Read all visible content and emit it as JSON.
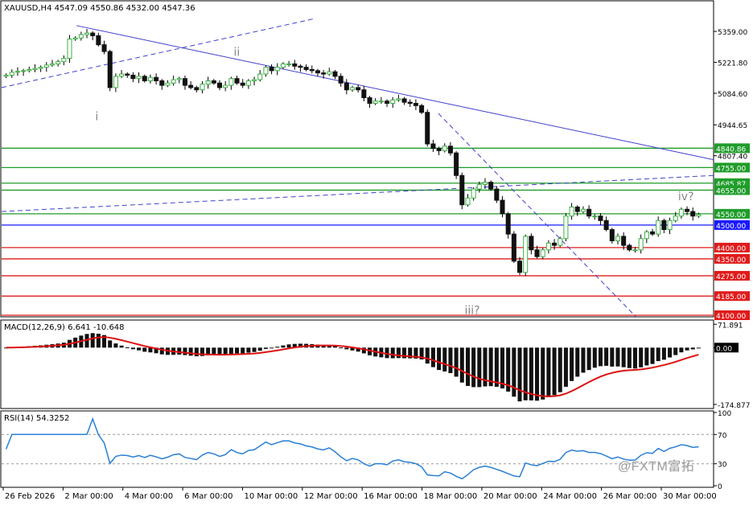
{
  "chart_header": {
    "symbol_info": "XAUUSD,H4  4547.09 4550.86 4532.00 4547.36"
  },
  "watermark": "@FXTM富拓",
  "colors": {
    "bull": "#3cb043",
    "bear": "#111111",
    "hline_green": "#1f9d2a",
    "hline_red": "#e01b1b",
    "hline_blue": "#1a1aff",
    "trend_blue": "#4040cc",
    "macd_signal": "#dd1111",
    "rsi_line": "#2a7fd4",
    "grid_border": "#000000"
  },
  "chart_data": [
    {
      "type": "candlestick",
      "title": "XAUUSD,H4",
      "yaxis_ticks": [
        5359.0,
        5221.8,
        5084.6,
        4944.65,
        4807.4
      ],
      "ylim": [
        4100,
        5420
      ],
      "xaxis_ticks": [
        "26 Feb 2026",
        "2 Mar 00:00",
        "4 Mar 00:00",
        "6 Mar 00:00",
        "10 Mar 00:00",
        "12 Mar 00:00",
        "16 Mar 00:00",
        "18 Mar 00:00",
        "20 Mar 00:00",
        "24 Mar 00:00",
        "26 Mar 00:00",
        "30 Mar 00:00"
      ],
      "closes": [
        5165,
        5178,
        5182,
        5185,
        5190,
        5195,
        5200,
        5210,
        5215,
        5225,
        5240,
        5325,
        5330,
        5345,
        5352,
        5340,
        5300,
        5270,
        5110,
        5160,
        5170,
        5165,
        5150,
        5160,
        5140,
        5155,
        5140,
        5120,
        5130,
        5145,
        5150,
        5120,
        5110,
        5100,
        5125,
        5140,
        5130,
        5110,
        5120,
        5150,
        5130,
        5120,
        5140,
        5145,
        5170,
        5200,
        5185,
        5200,
        5215,
        5215,
        5205,
        5200,
        5190,
        5185,
        5175,
        5170,
        5180,
        5160,
        5130,
        5100,
        5110,
        5100,
        5065,
        5040,
        5050,
        5050,
        5040,
        5055,
        5060,
        5045,
        5040,
        5030,
        5000,
        4860,
        4840,
        4830,
        4850,
        4820,
        4720,
        4590,
        4620,
        4660,
        4680,
        4690,
        4660,
        4610,
        4550,
        4460,
        4340,
        4290,
        4450,
        4390,
        4360,
        4390,
        4420,
        4410,
        4440,
        4540,
        4580,
        4560,
        4570,
        4540,
        4540,
        4520,
        4480,
        4430,
        4450,
        4410,
        4390,
        4390,
        4440,
        4470,
        4460,
        4520,
        4480,
        4520,
        4540,
        4570,
        4560,
        4540,
        4547
      ],
      "horizontal_levels": [
        {
          "value": 4840.86,
          "label": "4840.86",
          "color": "green"
        },
        {
          "value": 4755.0,
          "label": "4755.00",
          "color": "green"
        },
        {
          "value": 4685.87,
          "label": "4685.87",
          "color": "green"
        },
        {
          "value": 4655.0,
          "label": "4655.00",
          "color": "green"
        },
        {
          "value": 4550.0,
          "label": "4550.00",
          "color": "green"
        },
        {
          "value": 4500.0,
          "label": "4500.00",
          "color": "blue"
        },
        {
          "value": 4400.0,
          "label": "4400.00",
          "color": "red"
        },
        {
          "value": 4350.0,
          "label": "4350.00",
          "color": "red"
        },
        {
          "value": 4275.0,
          "label": "4275.00",
          "color": "red"
        },
        {
          "value": 4185.0,
          "label": "4185.00",
          "color": "red"
        },
        {
          "value": 4100.0,
          "label": "4100.00",
          "color": "red"
        }
      ],
      "wave_labels": [
        "i",
        "ii",
        "iii?",
        "iv?"
      ],
      "grid": false
    },
    {
      "type": "histogram+line",
      "title": "MACD(12,26,9) 6.641 -10.648",
      "yaxis_ticks": [
        71.891,
        0.0,
        -174.877
      ],
      "ylim": [
        -180,
        75
      ],
      "current_value_label": "0.00"
    },
    {
      "type": "line",
      "title": "RSI(14) 54.3252",
      "yaxis_ticks": [
        100,
        70,
        30,
        0
      ],
      "ylim": [
        0,
        100
      ],
      "levels": [
        70,
        30
      ]
    }
  ]
}
